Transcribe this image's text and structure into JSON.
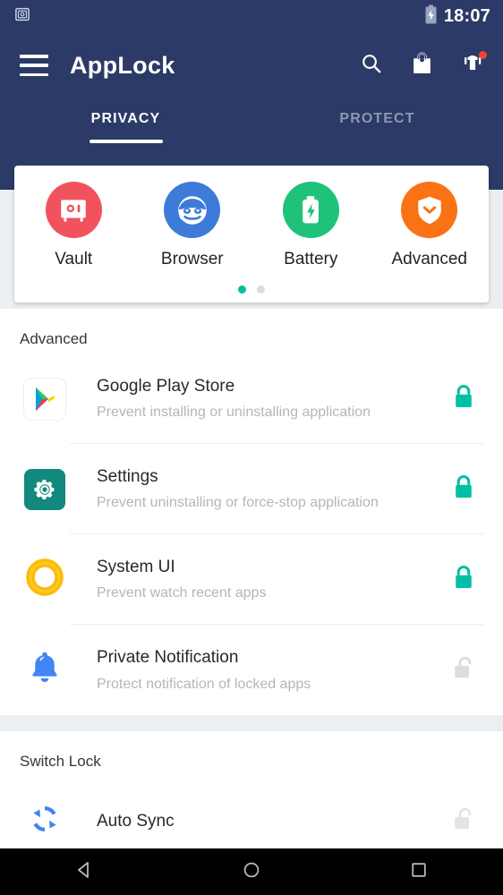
{
  "status_bar": {
    "notification_icon": "vault-icon",
    "battery_icon": "battery-charging-icon",
    "time": "18:07"
  },
  "app_bar": {
    "menu_icon": "hamburger-menu-icon",
    "title": "AppLock",
    "actions": [
      {
        "icon": "search-icon",
        "name": "search-button",
        "badge": false
      },
      {
        "icon": "shopping-bag-icon",
        "name": "store-button",
        "badge": false
      },
      {
        "icon": "theme-shirt-icon",
        "name": "theme-button",
        "badge": true
      }
    ]
  },
  "tabs": [
    {
      "label": "PRIVACY",
      "active": true
    },
    {
      "label": "PROTECT",
      "active": false
    }
  ],
  "feature_card": {
    "features": [
      {
        "label": "Vault",
        "icon": "vault-safe-icon",
        "color": "#f1535e"
      },
      {
        "label": "Browser",
        "icon": "incognito-mask-icon",
        "color": "#3d7bd9"
      },
      {
        "label": "Battery",
        "icon": "battery-bolt-icon",
        "color": "#1ec279"
      },
      {
        "label": "Advanced",
        "icon": "shield-chevron-icon",
        "color": "#f97316"
      }
    ],
    "page_dots": {
      "count": 2,
      "active_index": 0,
      "active_color": "#00bfa5",
      "inactive_color": "#dcdcdc"
    }
  },
  "sections": [
    {
      "title": "Advanced",
      "rows": [
        {
          "title": "Google Play Store",
          "subtitle": "Prevent installing or uninstalling application",
          "icon": "google-play-icon",
          "lock_state": "locked"
        },
        {
          "title": "Settings",
          "subtitle": "Prevent uninstalling or force-stop application",
          "icon": "settings-gear-icon",
          "lock_state": "locked"
        },
        {
          "title": "System UI",
          "subtitle": "Prevent watch recent apps",
          "icon": "system-ui-ring-icon",
          "lock_state": "locked"
        },
        {
          "title": "Private Notification",
          "subtitle": "Protect notification of locked apps",
          "icon": "bell-icon",
          "lock_state": "unlocked"
        }
      ]
    },
    {
      "title": "Switch Lock",
      "rows": [
        {
          "title": "Auto Sync",
          "subtitle": "",
          "icon": "auto-sync-icon",
          "lock_state": "unlocked"
        }
      ]
    }
  ],
  "nav_bar": {
    "back": "back-triangle-icon",
    "home": "home-circle-icon",
    "recents": "recents-square-icon"
  },
  "colors": {
    "header_bg": "#2b3a66",
    "lock_green": "#00bfa5",
    "lock_gray": "#dddddd",
    "badge_red": "#f4433a"
  }
}
